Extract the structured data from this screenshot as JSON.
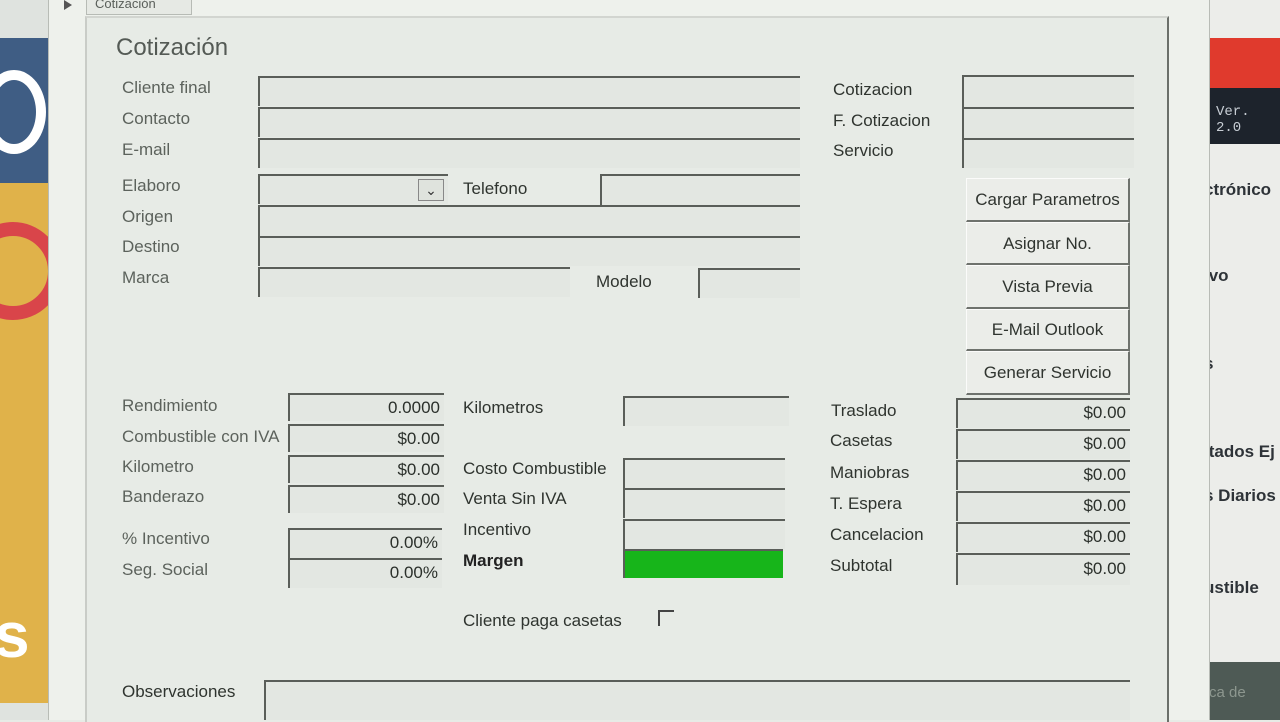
{
  "window": {
    "tab_label": "Cotización",
    "title": "Cotización"
  },
  "header_fields": {
    "cliente_final_label": "Cliente final",
    "contacto_label": "Contacto",
    "email_label": "E-mail",
    "elaboro_label": "Elaboro",
    "elaboro_value": "",
    "telefono_label": "Telefono",
    "origen_label": "Origen",
    "destino_label": "Destino",
    "marca_label": "Marca",
    "modelo_label": "Modelo"
  },
  "cotizacion_info": {
    "cotizacion_label": "Cotizacion",
    "f_cotizacion_label": "F. Cotizacion",
    "servicio_label": "Servicio"
  },
  "buttons": {
    "cargar_parametros": "Cargar Parametros",
    "asignar_no": "Asignar No.",
    "vista_previa": "Vista Previa",
    "email_outlook": "E-Mail Outlook",
    "generar_servicio": "Generar Servicio"
  },
  "costs_left": {
    "rendimiento_label": "Rendimiento",
    "rendimiento_value": "0.0000",
    "combustible_label": "Combustible con IVA",
    "combustible_value": "$0.00",
    "kilometro_label": "Kilometro",
    "kilometro_value": "$0.00",
    "banderazo_label": "Banderazo",
    "banderazo_value": "$0.00",
    "incentivo_pct_label": "% Incentivo",
    "incentivo_pct_value": "0.00%",
    "seg_social_label": "Seg. Social",
    "seg_social_value": "0.00%"
  },
  "costs_middle": {
    "kilometros_label": "Kilometros",
    "costo_combustible_label": "Costo Combustible",
    "venta_sin_iva_label": "Venta Sin IVA",
    "incentivo_label": "Incentivo",
    "margen_label": "Margen",
    "margen_color": "#17b51a",
    "cliente_paga_casetas_label": "Cliente paga casetas",
    "cliente_paga_casetas_checked": false
  },
  "costs_right": {
    "traslado_label": "Traslado",
    "traslado_value": "$0.00",
    "casetas_label": "Casetas",
    "casetas_value": "$0.00",
    "maniobras_label": "Maniobras",
    "maniobras_value": "$0.00",
    "t_espera_label": "T. Espera",
    "t_espera_value": "$0.00",
    "cancelacion_label": "Cancelacion",
    "cancelacion_value": "$0.00",
    "subtotal_label": "Subtotal",
    "subtotal_value": "$0.00"
  },
  "observaciones_label": "Observaciones",
  "background_app": {
    "version": "Ver. 2.0",
    "menu_fragments": [
      "ctrónico",
      "ivo",
      "s",
      "ltados Ej",
      "s Diarios",
      "ustible",
      "rca de"
    ]
  }
}
